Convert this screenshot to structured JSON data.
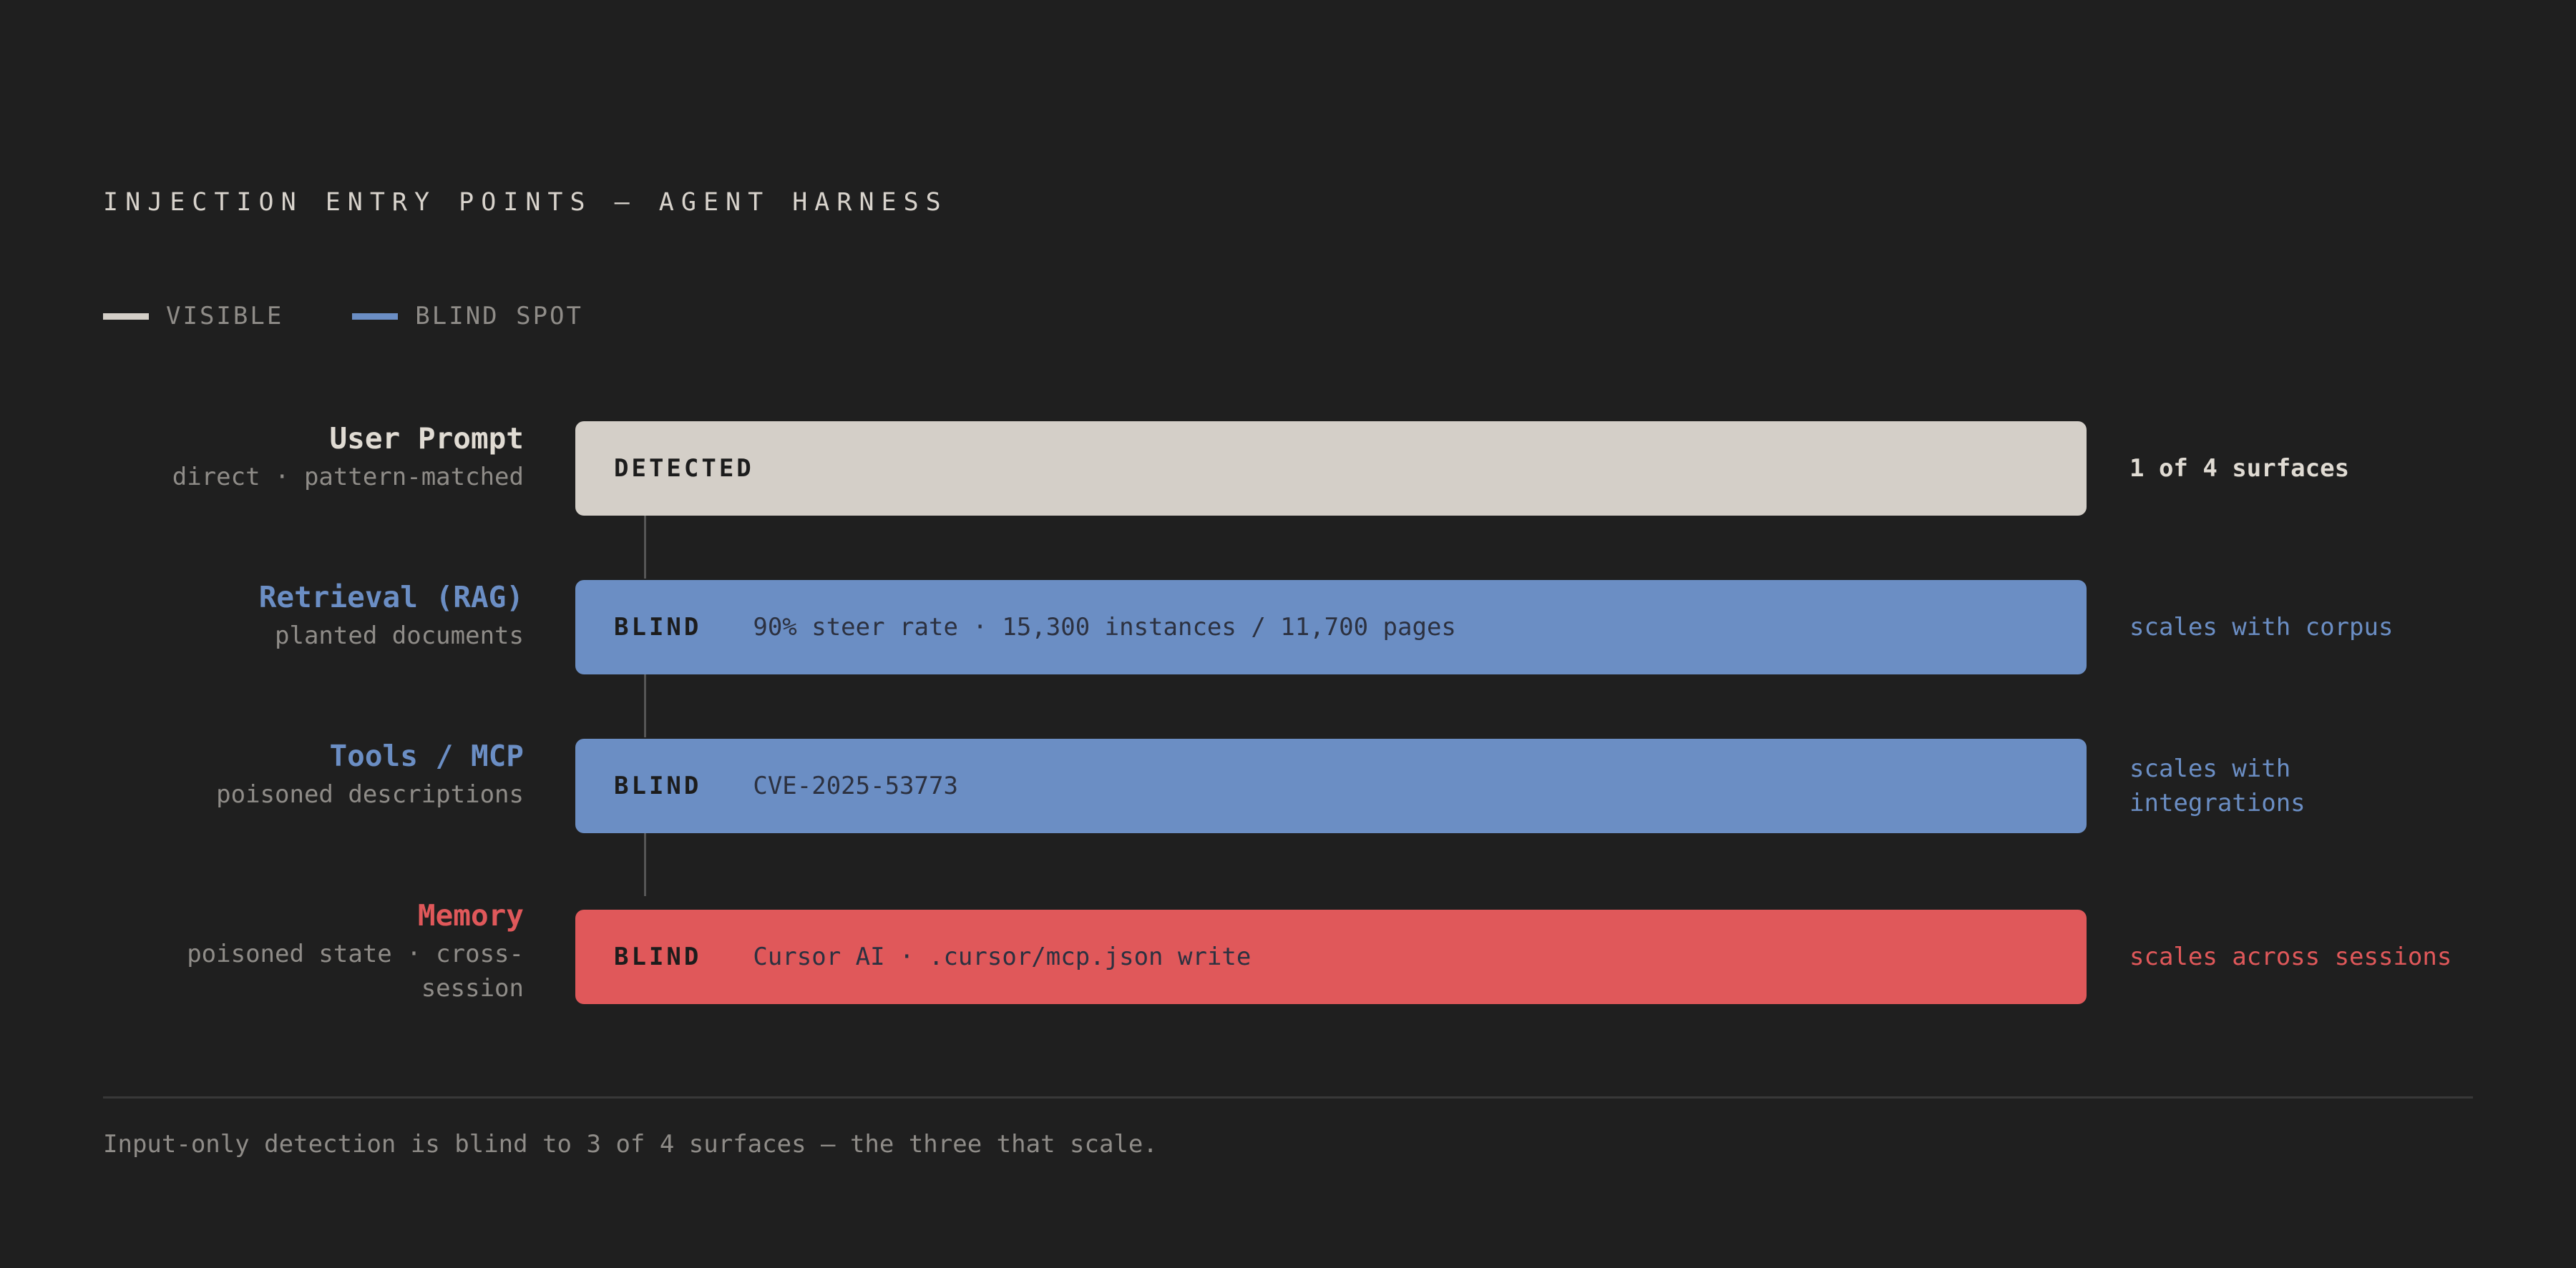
{
  "title": "INJECTION ENTRY POINTS — AGENT HARNESS",
  "legend": [
    {
      "label": "VISIBLE",
      "color": "#d4cfc8"
    },
    {
      "label": "BLIND SPOT",
      "color": "#6b8ec4"
    }
  ],
  "rows": [
    {
      "name": "User Prompt",
      "sub": "direct · pattern-matched",
      "status": "DETECTED",
      "detail": "",
      "note": "1 of 4 surfaces",
      "bar_color": "#d4cfc8",
      "name_color": "#e0dbd3",
      "note_color": "#e0dbd3"
    },
    {
      "name": "Retrieval (RAG)",
      "sub": "planted documents",
      "status": "BLIND",
      "detail": "90% steer rate · 15,300 instances / 11,700 pages",
      "note": "scales with corpus",
      "bar_color": "#6b8ec4",
      "name_color": "#6b8ec4",
      "note_color": "#6b8ec4"
    },
    {
      "name": "Tools / MCP",
      "sub": "poisoned descriptions",
      "status": "BLIND",
      "detail": "CVE-2025-53773",
      "note": "scales with integrations",
      "bar_color": "#6b8ec4",
      "name_color": "#6b8ec4",
      "note_color": "#6b8ec4"
    },
    {
      "name": "Memory",
      "sub": "poisoned state · cross-session",
      "status": "BLIND",
      "detail": "Cursor AI · .cursor/mcp.json write",
      "note": "scales across sessions",
      "bar_color": "#e0585a",
      "name_color": "#e0585a",
      "note_color": "#e0585a"
    }
  ],
  "footer": "Input-only detection is blind to 3 of 4 surfaces — the three that scale."
}
